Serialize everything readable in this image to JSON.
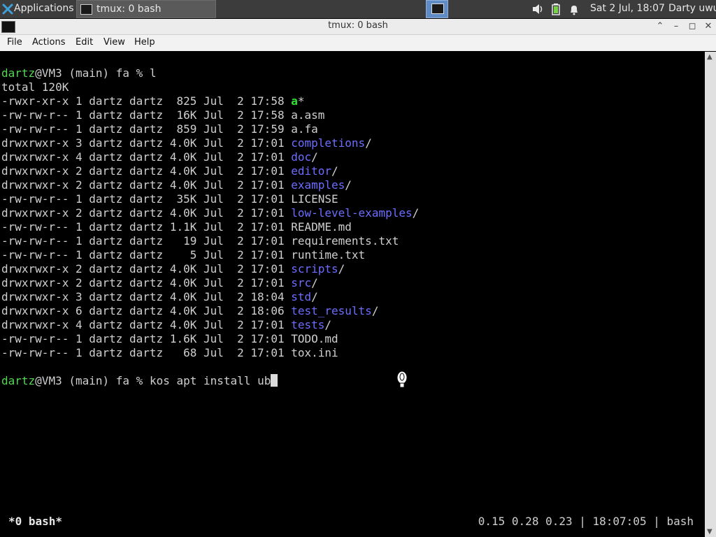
{
  "panel": {
    "applications_label": "Applications",
    "task_title": "tmux: 0 bash",
    "clock": "Sat  2 Jul, 18:07",
    "user": "Darty uwu"
  },
  "window": {
    "title": "tmux: 0 bash"
  },
  "menu": {
    "file": "File",
    "actions": "Actions",
    "edit": "Edit",
    "view": "View",
    "help": "Help"
  },
  "terminal": {
    "prompt_user": "dartz",
    "prompt_rest": "@VM3 (main) fa % ",
    "cmd1": "l",
    "total": "total 120K",
    "files": [
      {
        "meta": "-rwxr-xr-x 1 dartz dartz  825 Jul  2 17:58 ",
        "name": "a",
        "suffix": "*",
        "kind": "exec"
      },
      {
        "meta": "-rw-rw-r-- 1 dartz dartz  16K Jul  2 17:58 ",
        "name": "a.asm",
        "suffix": "",
        "kind": "file"
      },
      {
        "meta": "-rw-rw-r-- 1 dartz dartz  859 Jul  2 17:59 ",
        "name": "a.fa",
        "suffix": "",
        "kind": "file"
      },
      {
        "meta": "drwxrwxr-x 3 dartz dartz 4.0K Jul  2 17:01 ",
        "name": "completions",
        "suffix": "/",
        "kind": "dir"
      },
      {
        "meta": "drwxrwxr-x 4 dartz dartz 4.0K Jul  2 17:01 ",
        "name": "doc",
        "suffix": "/",
        "kind": "dir"
      },
      {
        "meta": "drwxrwxr-x 2 dartz dartz 4.0K Jul  2 17:01 ",
        "name": "editor",
        "suffix": "/",
        "kind": "dir"
      },
      {
        "meta": "drwxrwxr-x 2 dartz dartz 4.0K Jul  2 17:01 ",
        "name": "examples",
        "suffix": "/",
        "kind": "dir"
      },
      {
        "meta": "-rw-rw-r-- 1 dartz dartz  35K Jul  2 17:01 ",
        "name": "LICENSE",
        "suffix": "",
        "kind": "file"
      },
      {
        "meta": "drwxrwxr-x 2 dartz dartz 4.0K Jul  2 17:01 ",
        "name": "low-level-examples",
        "suffix": "/",
        "kind": "dir"
      },
      {
        "meta": "-rw-rw-r-- 1 dartz dartz 1.1K Jul  2 17:01 ",
        "name": "README.md",
        "suffix": "",
        "kind": "file"
      },
      {
        "meta": "-rw-rw-r-- 1 dartz dartz   19 Jul  2 17:01 ",
        "name": "requirements.txt",
        "suffix": "",
        "kind": "file"
      },
      {
        "meta": "-rw-rw-r-- 1 dartz dartz    5 Jul  2 17:01 ",
        "name": "runtime.txt",
        "suffix": "",
        "kind": "file"
      },
      {
        "meta": "drwxrwxr-x 2 dartz dartz 4.0K Jul  2 17:01 ",
        "name": "scripts",
        "suffix": "/",
        "kind": "dir"
      },
      {
        "meta": "drwxrwxr-x 2 dartz dartz 4.0K Jul  2 17:01 ",
        "name": "src",
        "suffix": "/",
        "kind": "dir"
      },
      {
        "meta": "drwxrwxr-x 3 dartz dartz 4.0K Jul  2 18:04 ",
        "name": "std",
        "suffix": "/",
        "kind": "dir"
      },
      {
        "meta": "drwxrwxr-x 6 dartz dartz 4.0K Jul  2 18:06 ",
        "name": "test_results",
        "suffix": "/",
        "kind": "dir"
      },
      {
        "meta": "drwxrwxr-x 4 dartz dartz 4.0K Jul  2 17:01 ",
        "name": "tests",
        "suffix": "/",
        "kind": "dir"
      },
      {
        "meta": "-rw-rw-r-- 1 dartz dartz 1.6K Jul  2 17:01 ",
        "name": "TODO.md",
        "suffix": "",
        "kind": "file"
      },
      {
        "meta": "-rw-rw-r-- 1 dartz dartz   68 Jul  2 17:01 ",
        "name": "tox.ini",
        "suffix": "",
        "kind": "file"
      }
    ],
    "cmd2": "kos apt install ub"
  },
  "tmux": {
    "window_label": "*0 bash*",
    "status_right": "0.15 0.28 0.23 | 18:07:05 | bash"
  },
  "colors": {
    "prompt_user": "#55d655",
    "directory": "#6d6dff",
    "executable": "#33e033",
    "workspace_active": "#5f8cc6"
  }
}
